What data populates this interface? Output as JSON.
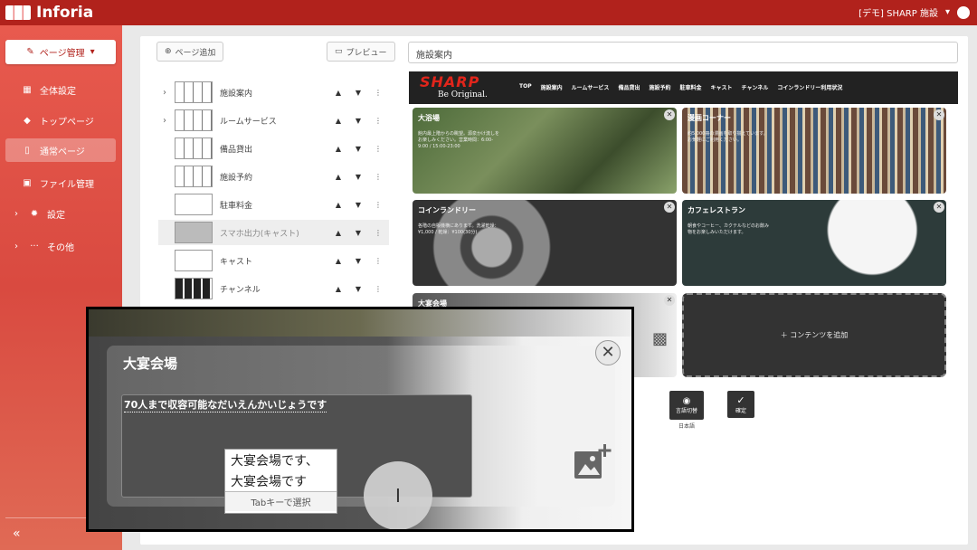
{
  "app": {
    "name": "Inforia",
    "account": "[デモ] SHARP 施設"
  },
  "sidebar": {
    "page_menu": "ページ管理",
    "items": [
      {
        "label": "全体設定"
      },
      {
        "label": "トップページ"
      },
      {
        "label": "通常ページ"
      },
      {
        "label": "ファイル管理"
      },
      {
        "label": "設定"
      },
      {
        "label": "その他"
      }
    ],
    "collapse_icon": "«"
  },
  "toolbar": {
    "add_page": "ページ追加",
    "preview": "プレビュー",
    "page_title": "施設案内"
  },
  "pages": [
    {
      "label": "施設案内"
    },
    {
      "label": "ルームサービス"
    },
    {
      "label": "備品貸出"
    },
    {
      "label": "施設予約"
    },
    {
      "label": "駐車料金"
    },
    {
      "label": "スマホ出力(キャスト)"
    },
    {
      "label": "キャスト"
    },
    {
      "label": "チャンネル"
    }
  ],
  "preview": {
    "brand": "SHARP",
    "brand_sub": "Be Original.",
    "nav": [
      "TOP",
      "施設案内",
      "ルームサービス",
      "備品貸出",
      "施設予約",
      "駐車料金",
      "キャスト",
      "チャンネル",
      "コインランドリー利用状況"
    ],
    "cards": [
      {
        "title": "大浴場",
        "desc": "館内最上階からの眺望。源泉かけ流しをお楽しみください。営業時間：6:00-9:00 / 15:00-23:00"
      },
      {
        "title": "漫画コーナー",
        "desc": "約5,000冊の漫画を取り揃えています。お気軽にご利用ください。"
      },
      {
        "title": "コインランドリー",
        "desc": "各階の自販機横にあります。洗濯乾燥：¥1,000 / 乾燥：¥100(30分)"
      },
      {
        "title": "カフェレストラン",
        "desc": "朝食やコーヒー、カクテルなどのお飲み物をお楽しみいただけます。"
      },
      {
        "title": "大宴会場",
        "desc": ""
      }
    ],
    "add_content": "＋ コンテンツを追加"
  },
  "actions": [
    {
      "label": "言語切替",
      "sub": "日本語"
    },
    {
      "label": "確定"
    }
  ],
  "zoom": {
    "card_title": "大宴会場",
    "typed_text": "70人まで収容可能なだいえんかいじょうです",
    "ime_options": [
      "大宴会場です、",
      "大宴会場です"
    ],
    "ime_hint": "Tabキーで選択"
  }
}
